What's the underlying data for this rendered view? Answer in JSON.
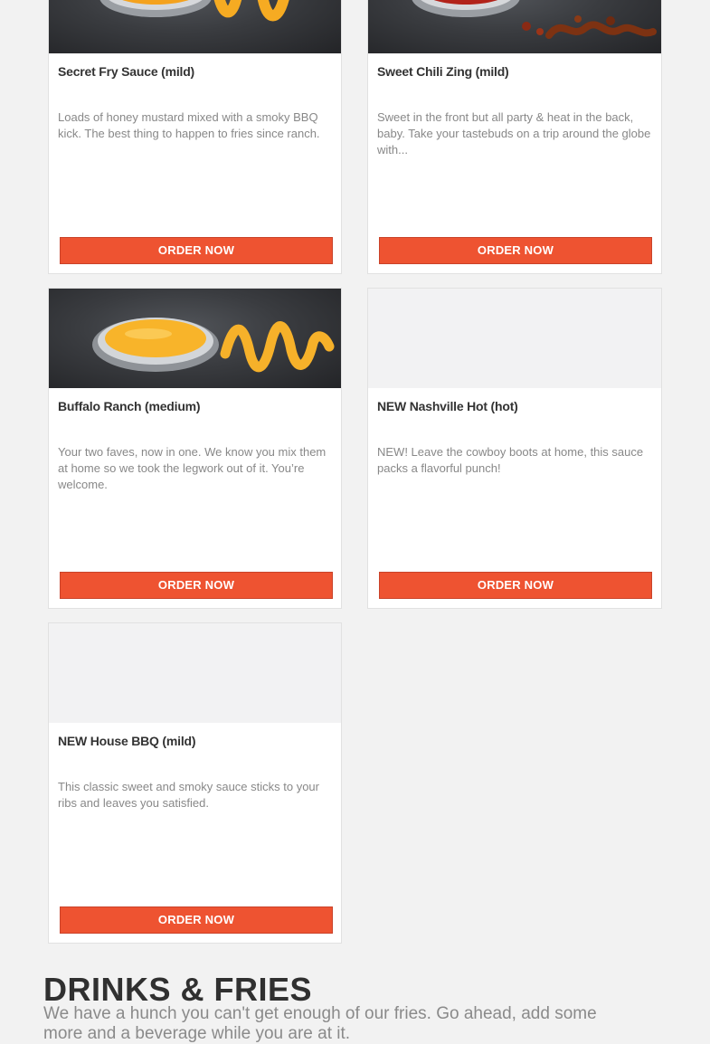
{
  "sauces": [
    {
      "name": "Secret Fry Sauce (mild)",
      "description": "Loads of honey mustard mixed with a smoky BBQ kick. The best thing to happen to fries since ranch.",
      "order_label": "ORDER NOW",
      "image_icon": "sauce-cup-orange-image",
      "sauce_color": "#f4a21e"
    },
    {
      "name": "Sweet Chili Zing (mild)",
      "description": "Sweet in the front but all party & heat in the back, baby. Take your tastebuds on a trip around the globe with...",
      "order_label": "ORDER NOW",
      "image_icon": "sauce-cup-red-image",
      "sauce_color": "#b2231a"
    },
    {
      "name": "Buffalo Ranch (medium)",
      "description": "Your two faves, now in one. We know you mix them at home so we took the legwork out of it. You’re welcome.",
      "order_label": "ORDER NOW",
      "image_icon": "sauce-cup-cheese-image",
      "sauce_color": "#f8b42a"
    },
    {
      "name": "NEW Nashville Hot (hot)",
      "description": "NEW! Leave the cowboy boots at home, this sauce packs a flavorful punch!",
      "order_label": "ORDER NOW",
      "image_icon": "image-placeholder"
    },
    {
      "name": "NEW House BBQ (mild)",
      "description": "This classic sweet and smoky sauce sticks to your ribs and leaves you satisfied.",
      "order_label": "ORDER NOW",
      "image_icon": "image-placeholder"
    }
  ],
  "drinks_section": {
    "heading": "DRINKS & FRIES",
    "subtext": "We have a hunch you can't get enough of our fries. Go ahead, add some more and a beverage while you are at it."
  },
  "colors": {
    "accent": "#ee5331",
    "page_background": "#f2f2f2",
    "card_background": "#ffffff"
  }
}
